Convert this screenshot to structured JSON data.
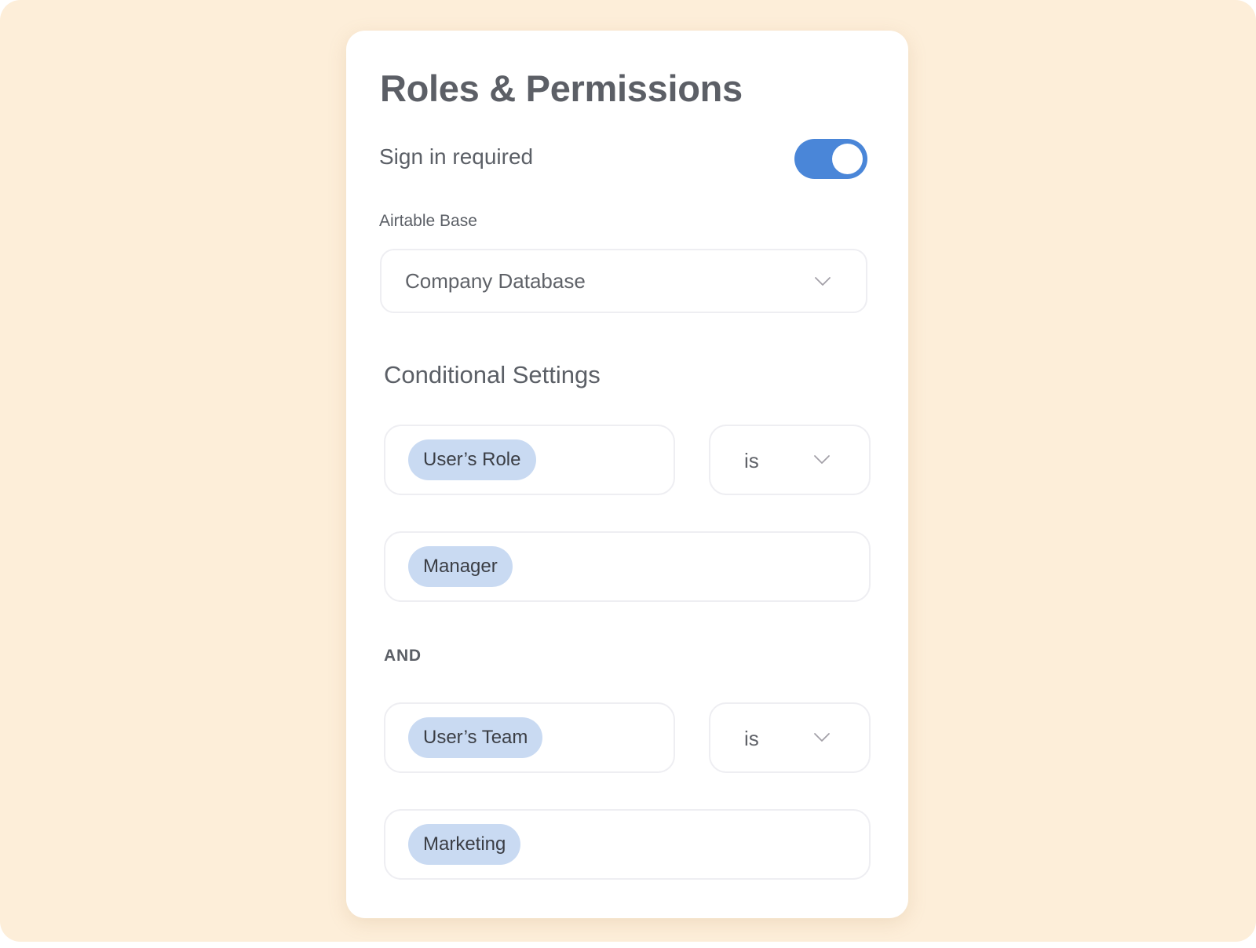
{
  "panel": {
    "title": "Roles & Permissions",
    "sign_in": {
      "label": "Sign in required",
      "enabled": true,
      "toggle_color": "#4a86d8"
    },
    "airtable_base": {
      "label": "Airtable Base",
      "selected": "Company Database",
      "icon": "chevron-down-icon"
    },
    "conditional_settings": {
      "title": "Conditional Settings",
      "conditions": [
        {
          "field": "User’s Role",
          "operator": "is",
          "value": "Manager"
        },
        {
          "field": "User’s Team",
          "operator": "is",
          "value": "Marketing"
        }
      ],
      "joiner": "AND"
    }
  },
  "colors": {
    "background": "#fdeed9",
    "card": "#ffffff",
    "chip": "#c9daf2",
    "text": "#5b5f66",
    "accent": "#4a86d8"
  }
}
